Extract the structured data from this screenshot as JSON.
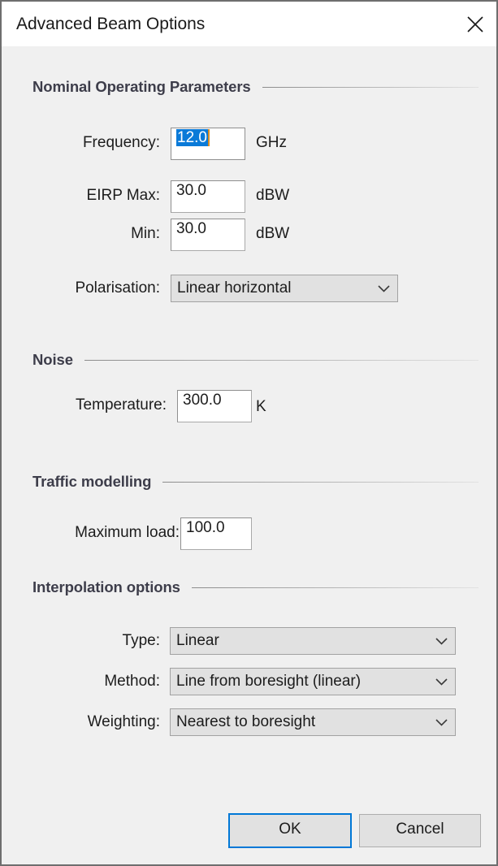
{
  "window": {
    "title": "Advanced Beam Options",
    "close_icon": "close-icon"
  },
  "sections": {
    "nominal": {
      "heading": "Nominal Operating Parameters",
      "fields": {
        "frequency": {
          "label": "Frequency:",
          "value": "12.0",
          "selected_text": "12.0",
          "unit": "GHz",
          "focused": true
        },
        "eirp_max": {
          "label": "EIRP Max:",
          "value": "30.0",
          "unit": "dBW"
        },
        "eirp_min": {
          "label": "Min:",
          "value": "30.0",
          "unit": "dBW"
        },
        "polarisation": {
          "label": "Polarisation:",
          "value": "Linear horizontal"
        }
      }
    },
    "noise": {
      "heading": "Noise",
      "fields": {
        "temperature": {
          "label": "Temperature:",
          "value": "300.0",
          "unit": "K"
        }
      }
    },
    "traffic": {
      "heading": "Traffic modelling",
      "fields": {
        "maximum_load": {
          "label": "Maximum load:",
          "value": "100.0",
          "unit": ""
        }
      }
    },
    "interpolation": {
      "heading": "Interpolation options",
      "fields": {
        "type": {
          "label": "Type:",
          "value": "Linear"
        },
        "method": {
          "label": "Method:",
          "value": "Line from boresight (linear)"
        },
        "weighting": {
          "label": "Weighting:",
          "value": "Nearest to boresight"
        }
      }
    }
  },
  "footer": {
    "ok_label": "OK",
    "cancel_label": "Cancel"
  },
  "colors": {
    "dialog_bg": "#f0f0f0",
    "titlebar_bg": "#ffffff",
    "accent_focus": "#0078d7",
    "selection_bg": "#0a7ad8",
    "caret": "#d98d23",
    "heading_text": "#3d3d4a",
    "window_border": "#6e6e6e"
  }
}
